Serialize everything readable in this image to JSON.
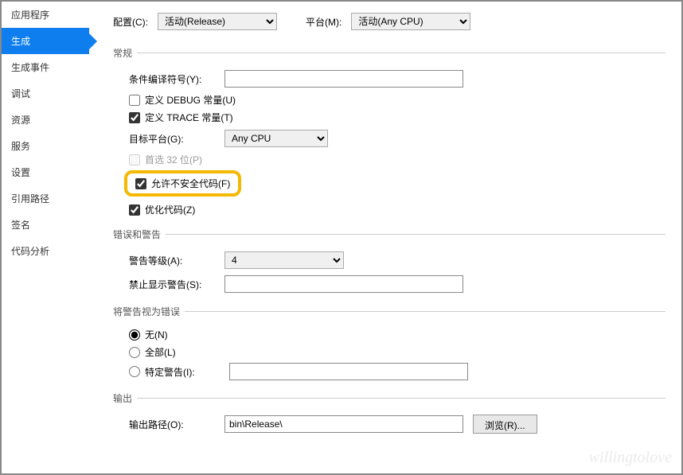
{
  "sidebar": {
    "items": [
      {
        "label": "应用程序"
      },
      {
        "label": "生成"
      },
      {
        "label": "生成事件"
      },
      {
        "label": "调试"
      },
      {
        "label": "资源"
      },
      {
        "label": "服务"
      },
      {
        "label": "设置"
      },
      {
        "label": "引用路径"
      },
      {
        "label": "签名"
      },
      {
        "label": "代码分析"
      }
    ],
    "activeIndex": 1
  },
  "topbar": {
    "config_label": "配置(C):",
    "config_value": "活动(Release)",
    "platform_label": "平台(M):",
    "platform_value": "活动(Any CPU)"
  },
  "sections": {
    "general": {
      "title": "常规",
      "conditional_label": "条件编译符号(Y):",
      "conditional_value": "",
      "debug_const": "定义 DEBUG 常量(U)",
      "trace_const": "定义 TRACE 常量(T)",
      "target_label": "目标平台(G):",
      "target_value": "Any CPU",
      "prefer32": "首选 32 位(P)",
      "unsafe": "允许不安全代码(F)",
      "optimize": "优化代码(Z)"
    },
    "errors": {
      "title": "错误和警告",
      "level_label": "警告等级(A):",
      "level_value": "4",
      "suppress_label": "禁止显示警告(S):",
      "suppress_value": ""
    },
    "treat": {
      "title": "将警告视为错误",
      "none": "无(N)",
      "all": "全部(L)",
      "specific": "特定警告(I):",
      "specific_value": ""
    },
    "output": {
      "title": "输出",
      "path_label": "输出路径(O):",
      "path_value": "bin\\Release\\",
      "browse": "浏览(R)..."
    }
  },
  "watermark": "willingtolove"
}
